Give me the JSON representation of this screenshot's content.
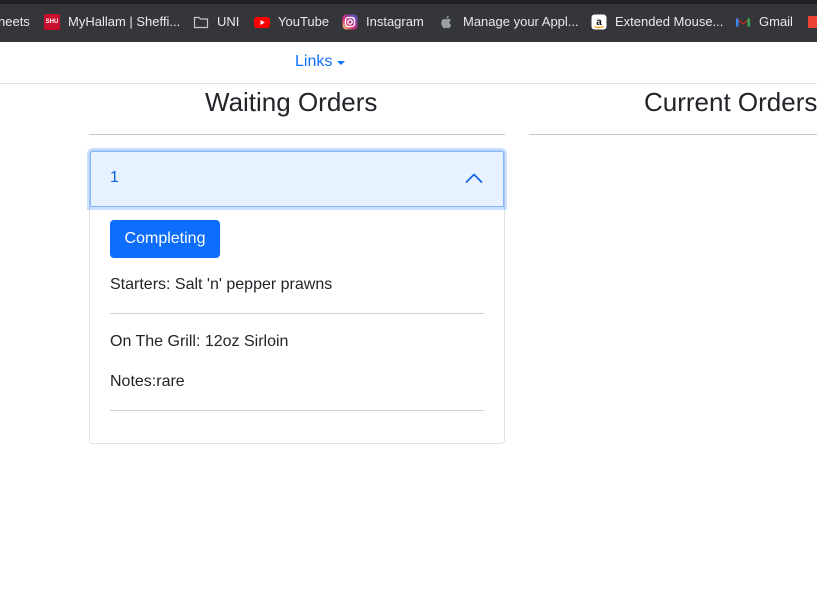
{
  "bookmarks": [
    {
      "label": "neets",
      "icon": "none"
    },
    {
      "label": "MyHallam | Sheffi...",
      "icon": "shu-logo-icon",
      "icon_text": "SHU"
    },
    {
      "label": "UNI",
      "icon": "folder-icon"
    },
    {
      "label": "YouTube",
      "icon": "youtube-icon"
    },
    {
      "label": "Instagram",
      "icon": "instagram-icon"
    },
    {
      "label": "Manage your Appl...",
      "icon": "apple-icon"
    },
    {
      "label": "Extended Mouse...",
      "icon": "amazon-icon"
    },
    {
      "label": "Gmail",
      "icon": "gmail-icon"
    }
  ],
  "navbar": {
    "links_label": "Links"
  },
  "columns": {
    "waiting_title": "Waiting Orders",
    "current_title": "Current Orders"
  },
  "order": {
    "number": "1",
    "complete_button": "Completing",
    "items": [
      {
        "text": "Starters: Salt 'n' pepper prawns"
      },
      {
        "text": "On The Grill: 12oz Sirloin"
      }
    ],
    "notes": "Notes:rare"
  },
  "colors": {
    "accent": "#0d6efd",
    "header_bg": "#e7f1ff",
    "bookmarks_bg": "#35363a"
  }
}
